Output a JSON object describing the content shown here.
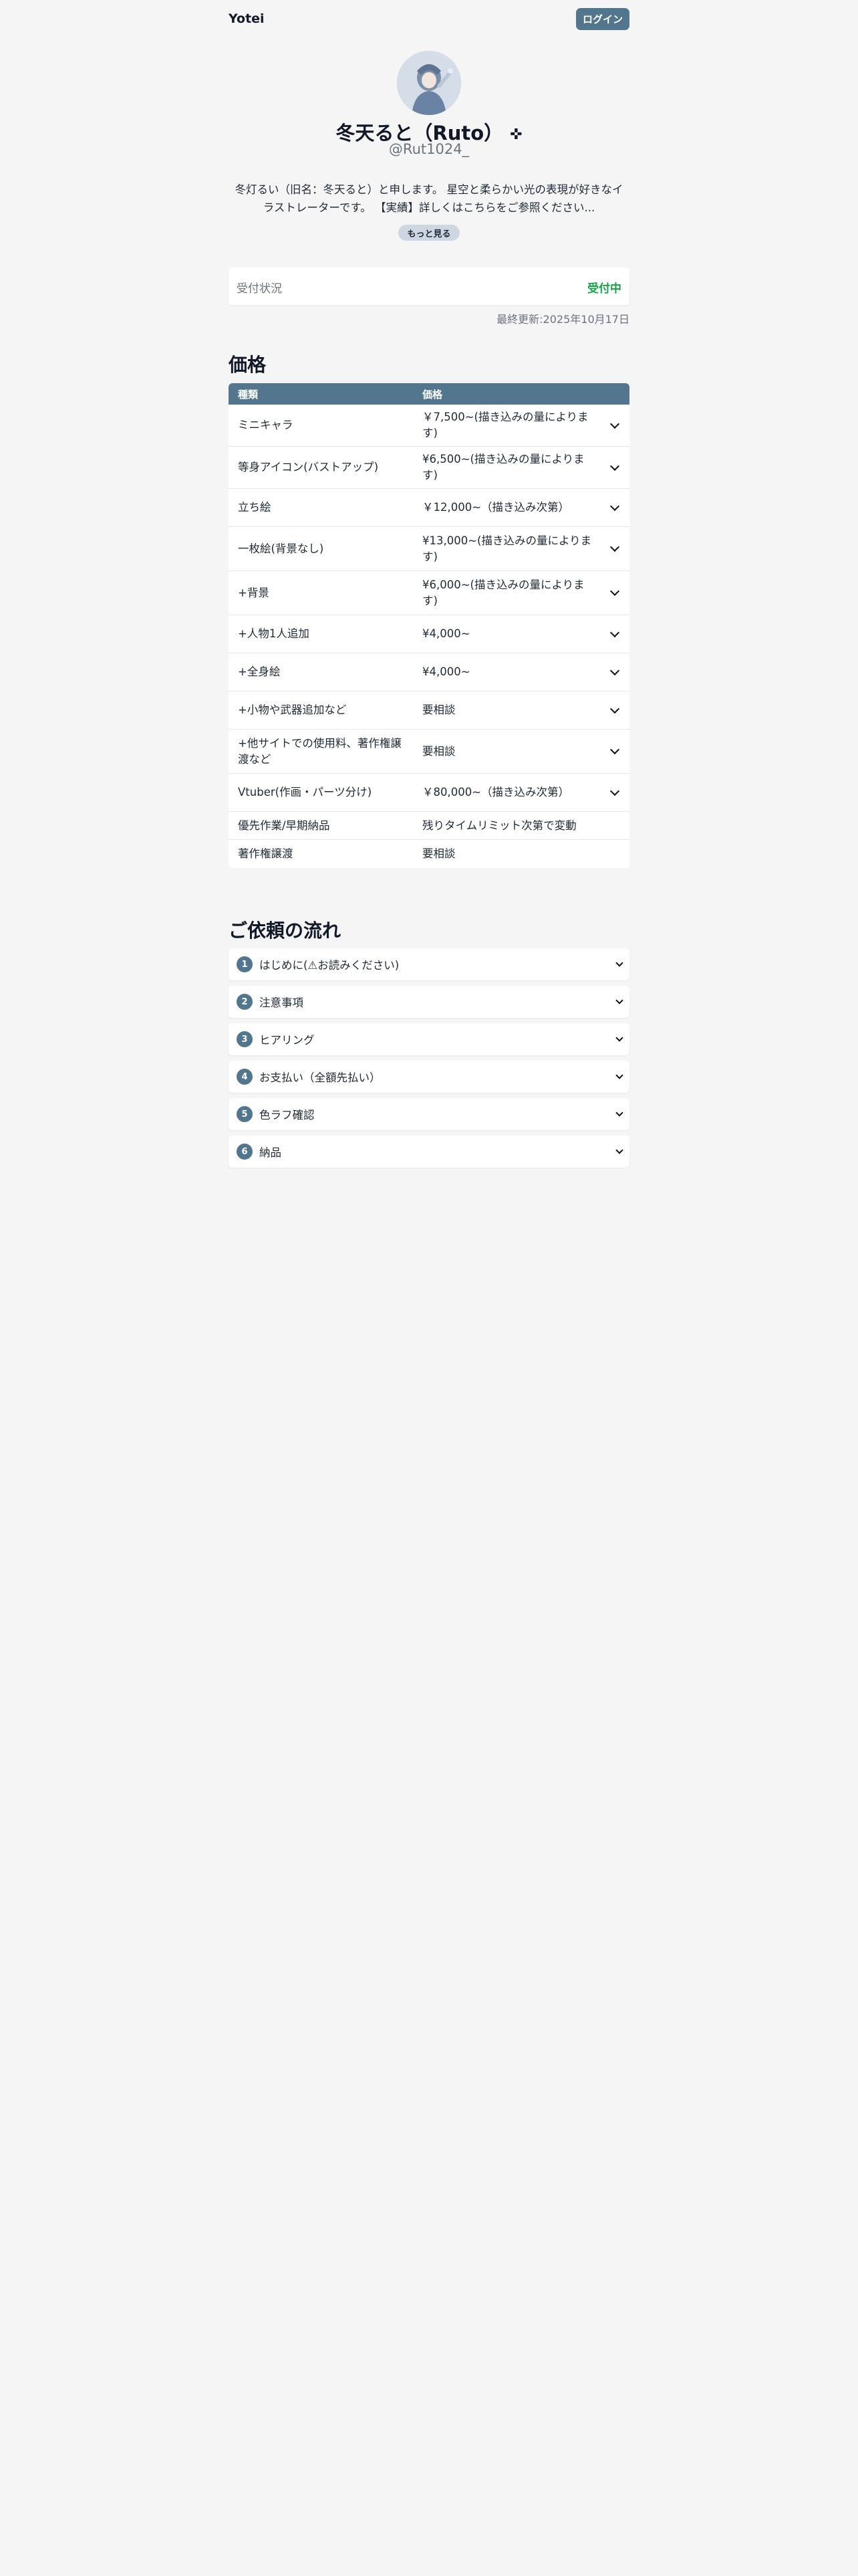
{
  "header": {
    "brand": "Yotei",
    "login_label": "ログイン"
  },
  "profile": {
    "name": "冬天ると（Ruto）",
    "name_badge": "✜",
    "handle": "@Rut1024_",
    "bio": "冬灯るい（旧名：冬天ると）と申します。 星空と柔らかい光の表現が好きなイラストレーターです。 【実績】詳しくはこちらをご参照ください...",
    "more_label": "もっと見る"
  },
  "status": {
    "label": "受付状況",
    "value": "受付中",
    "value_color": "#16a34a",
    "updated": "最終更新:2025年10月17日"
  },
  "price": {
    "title": "価格",
    "col_type": "種類",
    "col_price": "価格",
    "rows": [
      {
        "type": "ミニキャラ",
        "price": "￥7,500~(描き込みの量によります)",
        "expandable": true
      },
      {
        "type": "等身アイコン(バストアップ)",
        "price": "¥6,500~(描き込みの量によります)",
        "expandable": true
      },
      {
        "type": "立ち絵",
        "price": "￥12,000~（描き込み次第）",
        "expandable": true
      },
      {
        "type": "一枚絵(背景なし)",
        "price": "¥13,000~(描き込みの量によります)",
        "expandable": true
      },
      {
        "type": "+背景",
        "price": "¥6,000~(描き込みの量によります)",
        "expandable": true
      },
      {
        "type": "+人物1人追加",
        "price": "¥4,000~",
        "expandable": true
      },
      {
        "type": "+全身絵",
        "price": "¥4,000~",
        "expandable": true
      },
      {
        "type": "+小物や武器追加など",
        "price": "要相談",
        "expandable": true
      },
      {
        "type": "+他サイトでの使用料、著作権譲渡など",
        "price": "要相談",
        "expandable": true
      },
      {
        "type": "Vtuber(作画・パーツ分け)",
        "price": "￥80,000~（描き込み次第）",
        "expandable": true
      },
      {
        "type": "優先作業/早期納品",
        "price": "残りタイムリミット次第で変動",
        "expandable": false
      },
      {
        "type": "著作権譲渡",
        "price": "要相談",
        "expandable": false
      }
    ]
  },
  "flow": {
    "title": "ご依頼の流れ",
    "steps": [
      {
        "num": "1",
        "label": "はじめに(⚠お読みください)"
      },
      {
        "num": "2",
        "label": "注意事項"
      },
      {
        "num": "3",
        "label": "ヒアリング"
      },
      {
        "num": "4",
        "label": "お支払い（全額先払い）"
      },
      {
        "num": "5",
        "label": "色ラフ確認"
      },
      {
        "num": "6",
        "label": "納品"
      }
    ]
  },
  "colors": {
    "accent": "#53768f",
    "background": "#f5f5f5",
    "success": "#16a34a"
  }
}
